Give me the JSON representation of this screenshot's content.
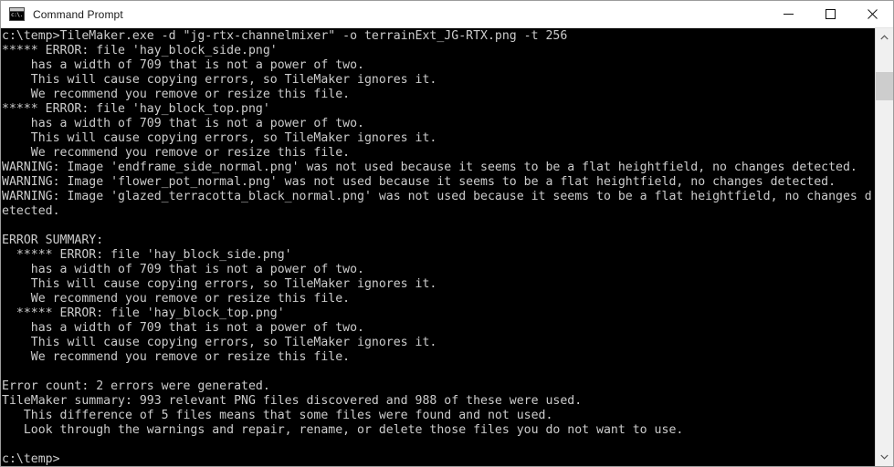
{
  "window": {
    "title": "Command Prompt",
    "icon": "console-icon",
    "icon_text": "c:\\.",
    "background": "#000000",
    "text_color": "#cccccc",
    "titlebar_color": "#ffffff"
  },
  "controls": {
    "minimize": "minimize-button",
    "maximize": "maximize-button",
    "close": "close-button"
  },
  "scrollbar": {
    "up_arrow": "scroll-up-arrow",
    "down_arrow": "scroll-down-arrow",
    "thumb": "scroll-thumb"
  },
  "terminal": {
    "lines": [
      "c:\\temp>TileMaker.exe -d \"jg-rtx-channelmixer\" -o terrainExt_JG-RTX.png -t 256",
      "***** ERROR: file 'hay_block_side.png'",
      "    has a width of 709 that is not a power of two.",
      "    This will cause copying errors, so TileMaker ignores it.",
      "    We recommend you remove or resize this file.",
      "***** ERROR: file 'hay_block_top.png'",
      "    has a width of 709 that is not a power of two.",
      "    This will cause copying errors, so TileMaker ignores it.",
      "    We recommend you remove or resize this file.",
      "WARNING: Image 'endframe_side_normal.png' was not used because it seems to be a flat heightfield, no changes detected.",
      "WARNING: Image 'flower_pot_normal.png' was not used because it seems to be a flat heightfield, no changes detected.",
      "WARNING: Image 'glazed_terracotta_black_normal.png' was not used because it seems to be a flat heightfield, no changes d",
      "etected.",
      "",
      "ERROR SUMMARY:",
      "  ***** ERROR: file 'hay_block_side.png'",
      "    has a width of 709 that is not a power of two.",
      "    This will cause copying errors, so TileMaker ignores it.",
      "    We recommend you remove or resize this file.",
      "  ***** ERROR: file 'hay_block_top.png'",
      "    has a width of 709 that is not a power of two.",
      "    This will cause copying errors, so TileMaker ignores it.",
      "    We recommend you remove or resize this file.",
      "",
      "Error count: 2 errors were generated.",
      "TileMaker summary: 993 relevant PNG files discovered and 988 of these were used.",
      "   This difference of 5 files means that some files were found and not used.",
      "   Look through the warnings and repair, rename, or delete those files you do not want to use.",
      "",
      "c:\\temp>"
    ]
  }
}
